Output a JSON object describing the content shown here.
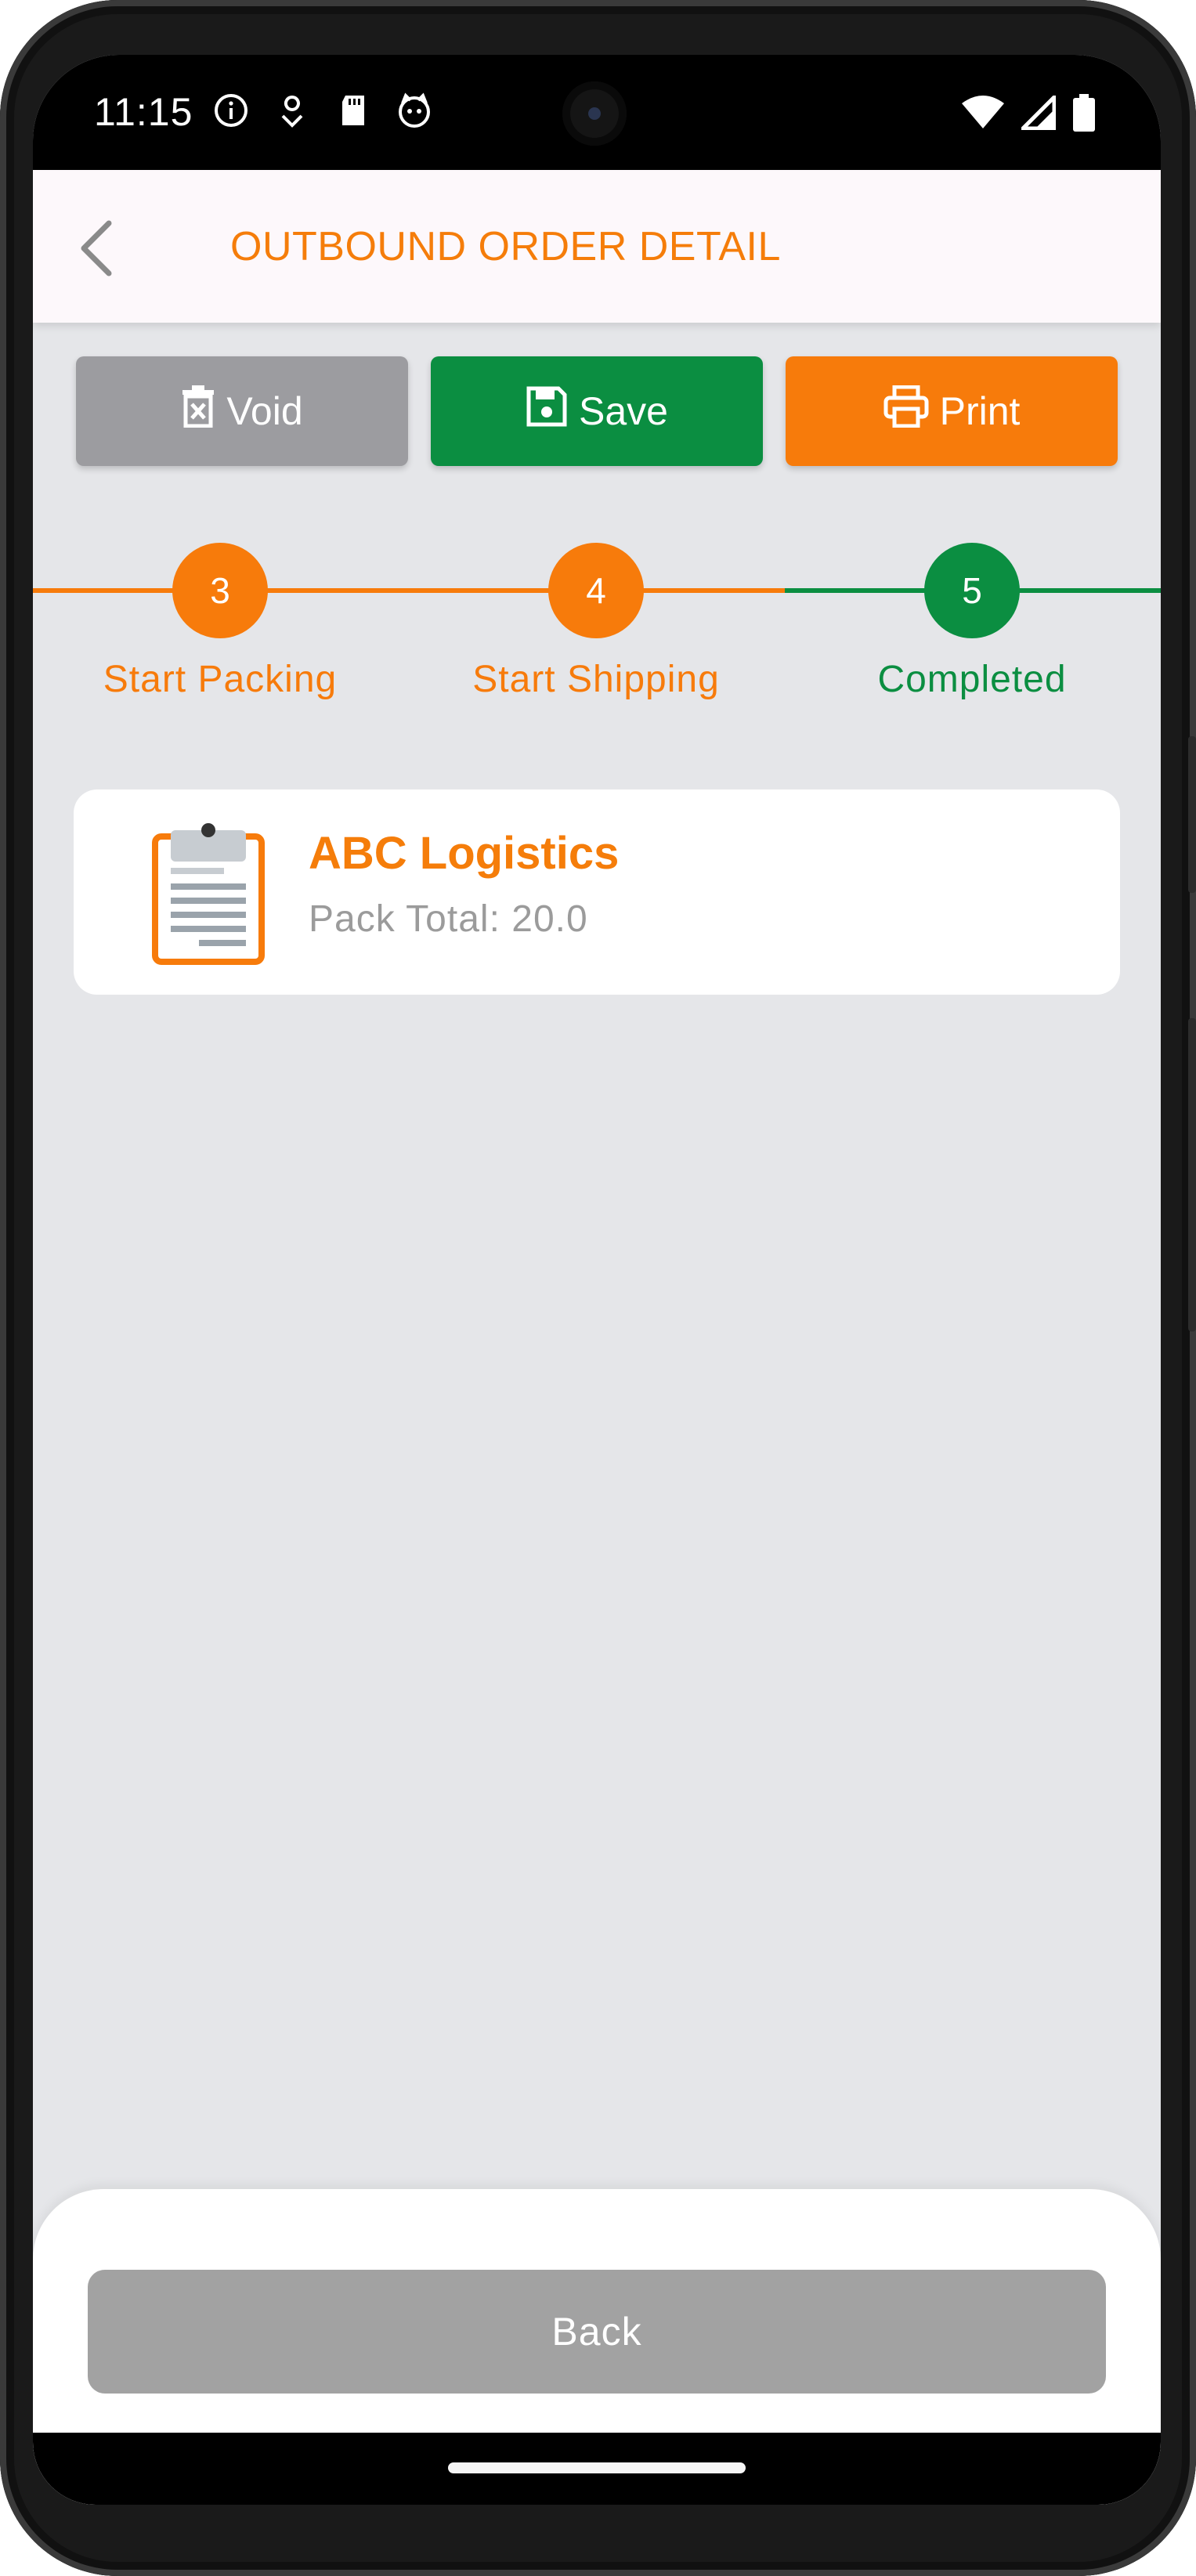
{
  "status_bar": {
    "time": "11:15",
    "left_icons": [
      "info-icon",
      "location-pin-icon",
      "sd-card-icon",
      "cat-face-icon"
    ],
    "right_icons": [
      "wifi-icon",
      "signal-icon",
      "battery-icon"
    ]
  },
  "app_bar": {
    "title": "OUTBOUND ORDER DETAIL",
    "back_icon": "chevron-left-icon"
  },
  "actions": {
    "void_label": "Void",
    "save_label": "Save",
    "print_label": "Print"
  },
  "stepper": {
    "steps": [
      {
        "number": "3",
        "label": "Start Packing",
        "status": "active"
      },
      {
        "number": "4",
        "label": "Start Shipping",
        "status": "active"
      },
      {
        "number": "5",
        "label": "Completed",
        "status": "completed"
      }
    ]
  },
  "order_card": {
    "company": "ABC Logistics",
    "pack_total": "Pack Total: 20.0",
    "icon": "clipboard-icon"
  },
  "footer": {
    "back_label": "Back"
  },
  "colors": {
    "orange": "#f77b0b",
    "green": "#0b8e41",
    "gray_button": "#9c9ca0",
    "background": "#e5e6e9"
  }
}
